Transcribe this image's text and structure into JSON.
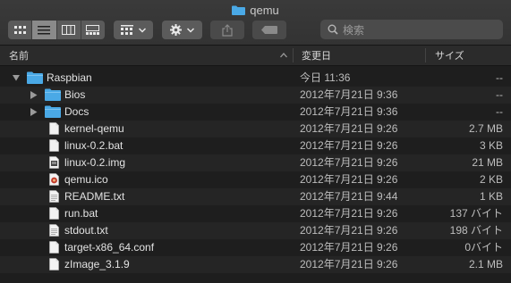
{
  "window": {
    "title": "qemu"
  },
  "toolbar": {
    "view_buttons": [
      "icon-view",
      "list-view",
      "column-view",
      "gallery-view"
    ],
    "active_view": "list-view",
    "group_button": "group-by",
    "action_button": "action-menu",
    "share_button": "share",
    "tag_button": "tags",
    "search": {
      "placeholder": "検索"
    }
  },
  "columns": {
    "name": "名前",
    "modified": "変更日",
    "size": "サイズ"
  },
  "colors": {
    "folder": "#4aa9e6",
    "background": "#1e1e1e",
    "row_alt": "#252525"
  },
  "rows": [
    {
      "name": "Raspbian",
      "date": "今日 11:36",
      "size": "--",
      "kind": "folder",
      "expanded": true,
      "level": 0
    },
    {
      "name": "Bios",
      "date": "2012年7月21日 9:36",
      "size": "--",
      "kind": "folder",
      "expanded": false,
      "level": 1
    },
    {
      "name": "Docs",
      "date": "2012年7月21日 9:36",
      "size": "--",
      "kind": "folder",
      "expanded": false,
      "level": 1
    },
    {
      "name": "kernel-qemu",
      "date": "2012年7月21日 9:26",
      "size": "2.7 MB",
      "kind": "file",
      "level": 1
    },
    {
      "name": "linux-0.2.bat",
      "date": "2012年7月21日 9:26",
      "size": "3 KB",
      "kind": "file",
      "level": 1
    },
    {
      "name": "linux-0.2.img",
      "date": "2012年7月21日 9:26",
      "size": "21 MB",
      "kind": "image",
      "level": 1
    },
    {
      "name": "qemu.ico",
      "date": "2012年7月21日 9:26",
      "size": "2 KB",
      "kind": "ico",
      "level": 1
    },
    {
      "name": "README.txt",
      "date": "2012年7月21日 9:44",
      "size": "1 KB",
      "kind": "file",
      "level": 1
    },
    {
      "name": "run.bat",
      "date": "2012年7月21日 9:26",
      "size": "137 バイト",
      "kind": "file",
      "level": 1
    },
    {
      "name": "stdout.txt",
      "date": "2012年7月21日 9:26",
      "size": "198 バイト",
      "kind": "file",
      "level": 1
    },
    {
      "name": "target-x86_64.conf",
      "date": "2012年7月21日 9:26",
      "size": "0バイト",
      "kind": "file",
      "level": 1
    },
    {
      "name": "zImage_3.1.9",
      "date": "2012年7月21日 9:26",
      "size": "2.1 MB",
      "kind": "file",
      "level": 1
    }
  ]
}
